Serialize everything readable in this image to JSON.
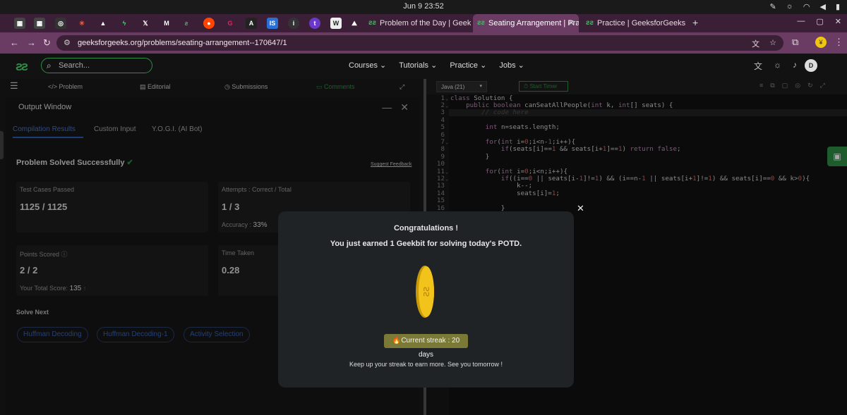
{
  "os": {
    "clock": "Jun 9  23:52"
  },
  "browser": {
    "tabs": [
      {
        "label": "Problem of the Day | Geek"
      },
      {
        "label": "Seating Arrangement | Pra",
        "active": true
      },
      {
        "label": "Practice | GeeksforGeeks"
      }
    ],
    "pinned_icons": [
      "grid-icon",
      "grid-icon",
      "chatgpt-icon",
      "star-icon",
      "triangle-icon",
      "bolt-icon",
      "x-icon",
      "medium-icon",
      "gfg-icon",
      "reddit-icon",
      "g-icon",
      "a-icon",
      "is-icon",
      "info-icon",
      "t-icon",
      "w-icon",
      "mountain-icon"
    ],
    "url": "geeksforgeeks.org/problems/seating-arrangement--170647/1"
  },
  "header": {
    "search_placeholder": "Search...",
    "nav": [
      "Courses",
      "Tutorials",
      "Practice",
      "Jobs"
    ],
    "avatar_letter": "D"
  },
  "left_tabs": [
    "Problem",
    "Editorial",
    "Submissions",
    "Comments"
  ],
  "output": {
    "title": "Output Window",
    "tabs": [
      "Compilation Results",
      "Custom Input",
      "Y.O.G.I. (AI Bot)"
    ],
    "status": "Problem Solved Successfully",
    "suggest_feedback": "Suggest Feedback",
    "test_cases_label": "Test Cases Passed",
    "test_cases_value": "1125 / 1125",
    "attempts_label": "Attempts : Correct / Total",
    "attempts_value": "1 / 3",
    "accuracy_label": "Accuracy :",
    "accuracy_value": "33%",
    "points_label": "Points Scored",
    "points_value": "2 / 2",
    "total_score_label": "Your Total Score:",
    "total_score_value": "135",
    "time_label": "Time Taken",
    "time_value": "0.28",
    "solve_next_label": "Solve Next",
    "solve_next": [
      "Huffman Decoding",
      "Huffman Decoding-1",
      "Activity Selection"
    ]
  },
  "editor": {
    "language": "Java (21)",
    "start_timer": "Start Timer",
    "lines": [
      "class Solution {",
      "    public boolean canSeatAllPeople(int k, int[] seats) {",
      "        // code here",
      "",
      "         int n=seats.length;",
      "",
      "         for(int i=0;i<n-1;i++){",
      "             if(seats[i]==1 && seats[i+1]==1) return false;",
      "         }",
      "",
      "         for(int i=0;i<n;i++){",
      "             if((i==0 || seats[i-1]!=1) && (i==n-1 || seats[i+1]!=1) && seats[i]==0 && k>0){",
      "                 k--;",
      "                 seats[i]=1;",
      "",
      "             }"
    ]
  },
  "modal": {
    "title": "Congratulations !",
    "subtitle": "You just earned 1 Geekbit for solving today's POTD.",
    "streak": "Current streak : 20 days",
    "footer": "Keep up your streak to earn more. See you tomorrow !"
  }
}
